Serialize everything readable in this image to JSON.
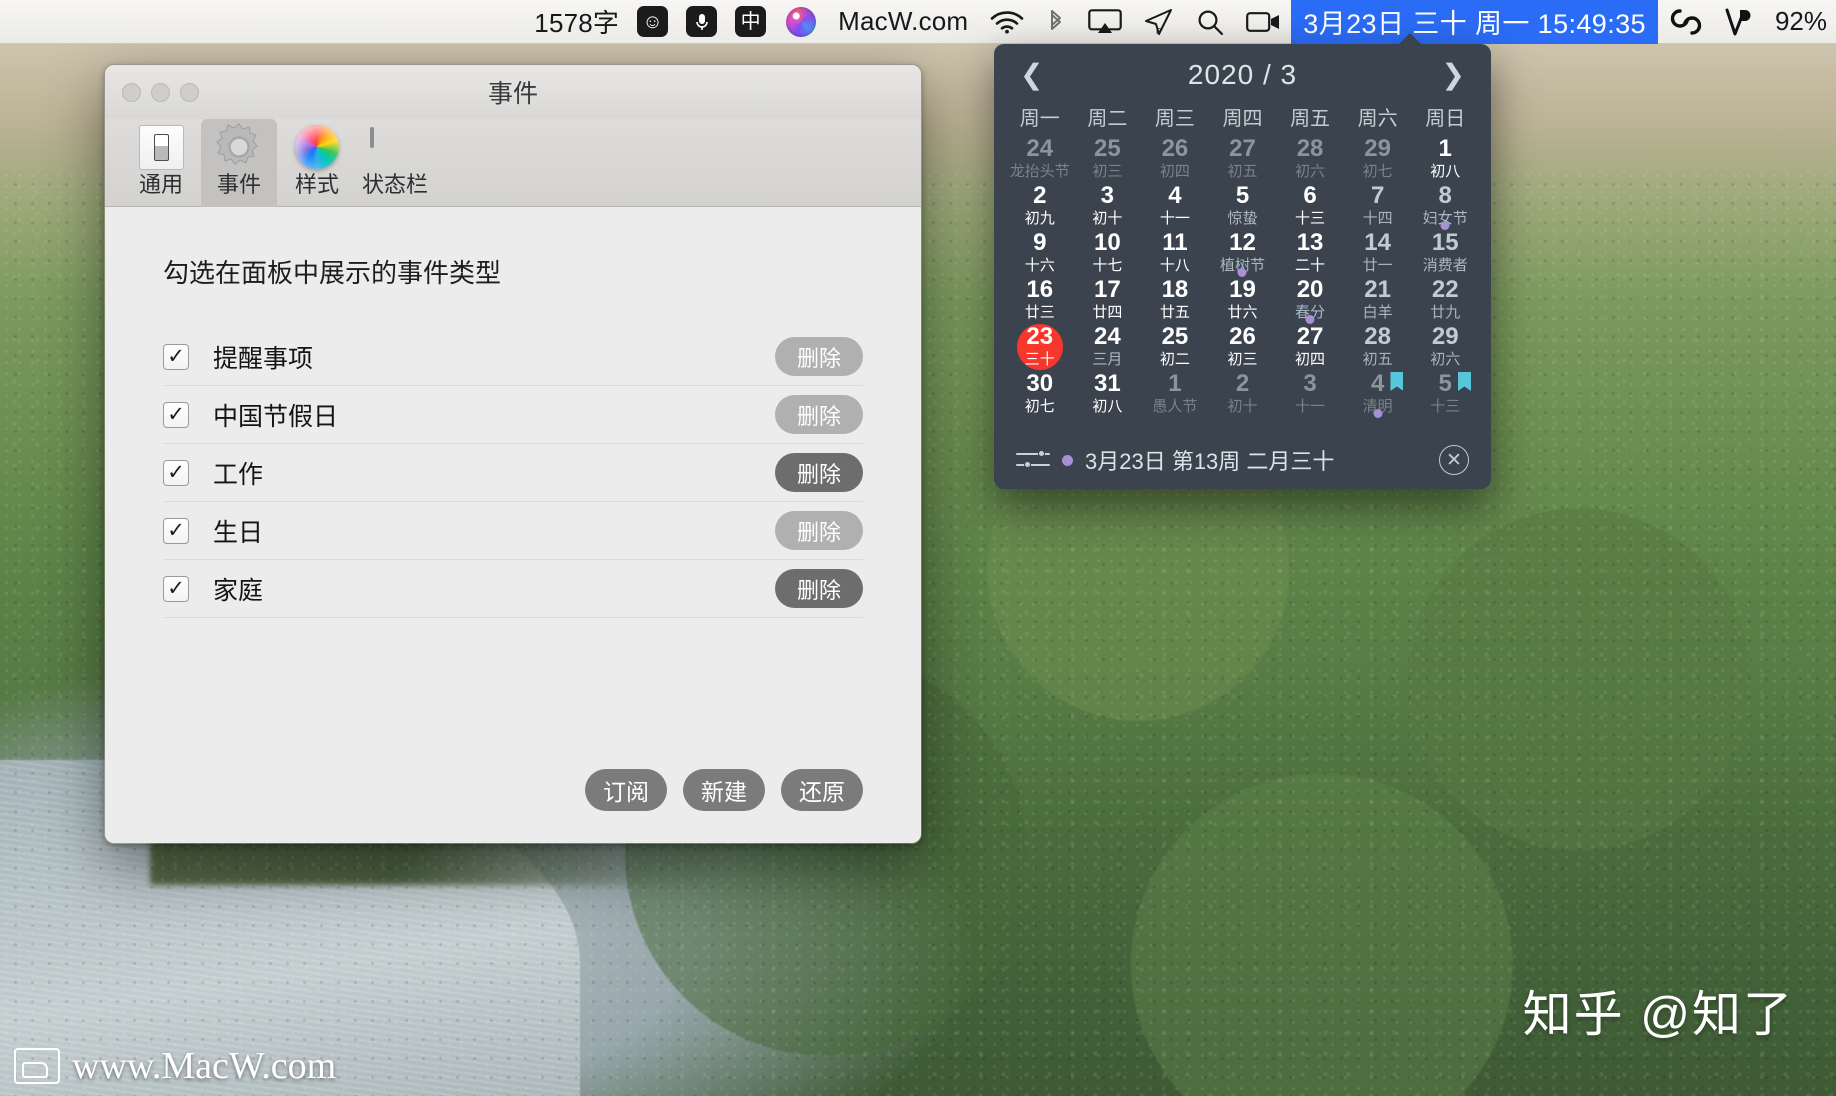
{
  "menubar": {
    "word_count": "1578字",
    "emoji_icon": "emoji-icon",
    "mic_icon": "mic-icon",
    "ime_label": "中",
    "siri_icon": "siri-icon",
    "app_name": "MacW.com",
    "wifi_icon": "wifi-icon",
    "bluetooth_icon": "bluetooth-icon",
    "airplay_icon": "airplay-icon",
    "send_icon": "send-icon",
    "search_icon": "search-icon",
    "screen_record_icon": "screen-record-icon",
    "clock": "3月23日 三十 周一 15:49:35",
    "creative_cloud_icon": "creative-cloud-icon",
    "vpn_icon": "vpn-icon",
    "battery_percent": "92%",
    "accent_blue": "#2b6cf6"
  },
  "window": {
    "title": "事件",
    "toolbar": [
      {
        "label": "通用",
        "icon": "general-icon",
        "selected": false
      },
      {
        "label": "事件",
        "icon": "gear-icon",
        "selected": true
      },
      {
        "label": "样式",
        "icon": "color-wheel-icon",
        "selected": false
      },
      {
        "label": "状态栏",
        "icon": "macbook-icon",
        "selected": false
      }
    ],
    "section_title": "勾选在面板中展示的事件类型",
    "delete_label": "删除",
    "checkmark": "✓",
    "rows": [
      {
        "label": "提醒事项",
        "checked": true,
        "delete_enabled": false
      },
      {
        "label": "中国节假日",
        "checked": true,
        "delete_enabled": false
      },
      {
        "label": "工作",
        "checked": true,
        "delete_enabled": true
      },
      {
        "label": "生日",
        "checked": true,
        "delete_enabled": false
      },
      {
        "label": "家庭",
        "checked": true,
        "delete_enabled": true
      }
    ],
    "footer_buttons": [
      {
        "label": "订阅"
      },
      {
        "label": "新建"
      },
      {
        "label": "还原"
      }
    ]
  },
  "calendar": {
    "prev_icon": "chevron-left-icon",
    "next_icon": "chevron-right-icon",
    "title": "2020 / 3",
    "weekdays": [
      "周一",
      "周二",
      "周三",
      "周四",
      "周五",
      "周六",
      "周日"
    ],
    "footer": {
      "settings_icon": "sliders-icon",
      "text": "3月23日 第13周 二月三十",
      "close_icon": "close-icon"
    },
    "days": [
      {
        "d": "24",
        "l": "龙抬头节",
        "state": "dim"
      },
      {
        "d": "25",
        "l": "初三",
        "state": "dim"
      },
      {
        "d": "26",
        "l": "初四",
        "state": "dim"
      },
      {
        "d": "27",
        "l": "初五",
        "state": "dim"
      },
      {
        "d": "28",
        "l": "初六",
        "state": "dim"
      },
      {
        "d": "29",
        "l": "初七",
        "state": "dim"
      },
      {
        "d": "1",
        "l": "初八",
        "state": "cur"
      },
      {
        "d": "2",
        "l": "初九",
        "state": "cur"
      },
      {
        "d": "3",
        "l": "初十",
        "state": "cur"
      },
      {
        "d": "4",
        "l": "十一",
        "state": "cur"
      },
      {
        "d": "5",
        "l": "惊蛰",
        "state": "cur",
        "fest": true
      },
      {
        "d": "6",
        "l": "十三",
        "state": "cur"
      },
      {
        "d": "7",
        "l": "十四",
        "state": "wknd"
      },
      {
        "d": "8",
        "l": "妇女节",
        "state": "wknd",
        "fest": true,
        "dot": true
      },
      {
        "d": "9",
        "l": "十六",
        "state": "cur"
      },
      {
        "d": "10",
        "l": "十七",
        "state": "cur"
      },
      {
        "d": "11",
        "l": "十八",
        "state": "cur"
      },
      {
        "d": "12",
        "l": "植树节",
        "state": "cur",
        "fest": true,
        "dot": true
      },
      {
        "d": "13",
        "l": "二十",
        "state": "cur"
      },
      {
        "d": "14",
        "l": "廿一",
        "state": "wknd"
      },
      {
        "d": "15",
        "l": "消费者",
        "state": "wknd",
        "fest": true
      },
      {
        "d": "16",
        "l": "廿三",
        "state": "cur"
      },
      {
        "d": "17",
        "l": "廿四",
        "state": "cur"
      },
      {
        "d": "18",
        "l": "廿五",
        "state": "cur"
      },
      {
        "d": "19",
        "l": "廿六",
        "state": "cur"
      },
      {
        "d": "20",
        "l": "春分",
        "state": "cur",
        "fest": true,
        "dot": true
      },
      {
        "d": "21",
        "l": "白羊",
        "state": "wknd",
        "fest": true
      },
      {
        "d": "22",
        "l": "廿九",
        "state": "wknd"
      },
      {
        "d": "23",
        "l": "三十",
        "state": "cur",
        "today": true
      },
      {
        "d": "24",
        "l": "三月",
        "state": "cur",
        "fest": true
      },
      {
        "d": "25",
        "l": "初二",
        "state": "cur"
      },
      {
        "d": "26",
        "l": "初三",
        "state": "cur"
      },
      {
        "d": "27",
        "l": "初四",
        "state": "cur"
      },
      {
        "d": "28",
        "l": "初五",
        "state": "wknd"
      },
      {
        "d": "29",
        "l": "初六",
        "state": "wknd"
      },
      {
        "d": "30",
        "l": "初七",
        "state": "cur"
      },
      {
        "d": "31",
        "l": "初八",
        "state": "cur"
      },
      {
        "d": "1",
        "l": "愚人节",
        "state": "dim"
      },
      {
        "d": "2",
        "l": "初十",
        "state": "dim"
      },
      {
        "d": "3",
        "l": "十一",
        "state": "dim"
      },
      {
        "d": "4",
        "l": "清明",
        "state": "dim",
        "flag": true,
        "dot": true
      },
      {
        "d": "5",
        "l": "十三",
        "state": "dim",
        "flag": true
      }
    ],
    "today_color": "#f7372b",
    "dot_color": "#a98fd4",
    "flag_color": "#58c6da"
  },
  "watermarks": {
    "bottom_left": "www.MacW.com",
    "bottom_right": "知乎 @知了"
  }
}
